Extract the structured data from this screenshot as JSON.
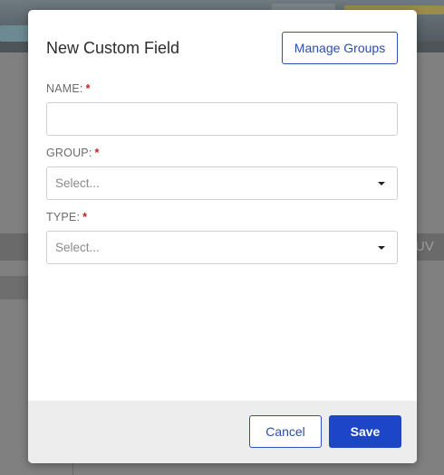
{
  "background": {
    "side_text": "UV"
  },
  "modal": {
    "title": "New Custom Field",
    "manage_groups_label": "Manage Groups",
    "fields": {
      "name": {
        "label": "NAME:",
        "required_mark": "*",
        "value": ""
      },
      "group": {
        "label": "GROUP:",
        "required_mark": "*",
        "placeholder": "Select..."
      },
      "type": {
        "label": "TYPE:",
        "required_mark": "*",
        "placeholder": "Select..."
      }
    },
    "footer": {
      "cancel_label": "Cancel",
      "save_label": "Save"
    }
  },
  "colors": {
    "primary": "#1d45c8",
    "required": "#c21f1f",
    "footer_bg": "#ededed"
  }
}
